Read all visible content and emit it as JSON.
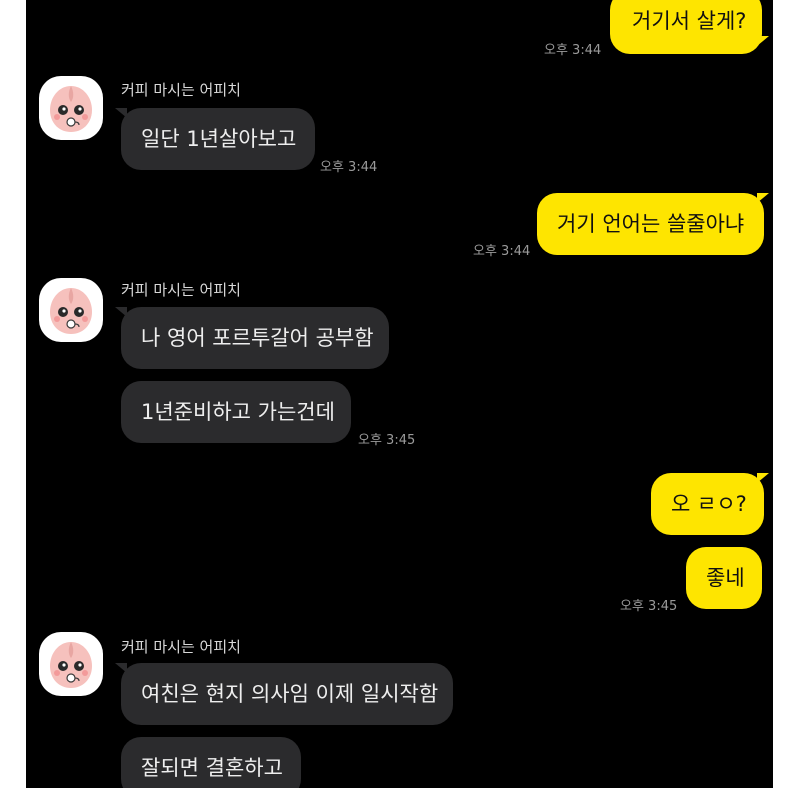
{
  "chat": {
    "messages": [
      {
        "from": "me",
        "text": "거기서 살게?",
        "time": "오후 3:44"
      },
      {
        "from": "them",
        "sender": "커피 마시는 어피치",
        "text": "일단 1년살아보고",
        "time": "오후 3:44"
      },
      {
        "from": "me",
        "text": "거기 언어는 쓸줄아냐",
        "time": "오후 3:44"
      },
      {
        "from": "them",
        "sender": "커피 마시는 어피치",
        "text": "나 영어 포르투갈어 공부함"
      },
      {
        "from": "them",
        "text": "1년준비하고 가는건데",
        "time": "오후 3:45"
      },
      {
        "from": "me",
        "text": "오 ㄹㅇ?"
      },
      {
        "from": "me",
        "text": "좋네",
        "time": "오후 3:45"
      },
      {
        "from": "them",
        "sender": "커피 마시는 어피치",
        "text": "여친은 현지 의사임 이제 일시작함"
      },
      {
        "from": "them",
        "text": "잘되면 결혼하고"
      }
    ]
  },
  "colors": {
    "background": "#000000",
    "my_bubble": "#fee500",
    "their_bubble": "#2b2b2d",
    "timestamp": "#9a9a9a"
  },
  "icons": {
    "avatar": "apeach-avatar-icon"
  }
}
